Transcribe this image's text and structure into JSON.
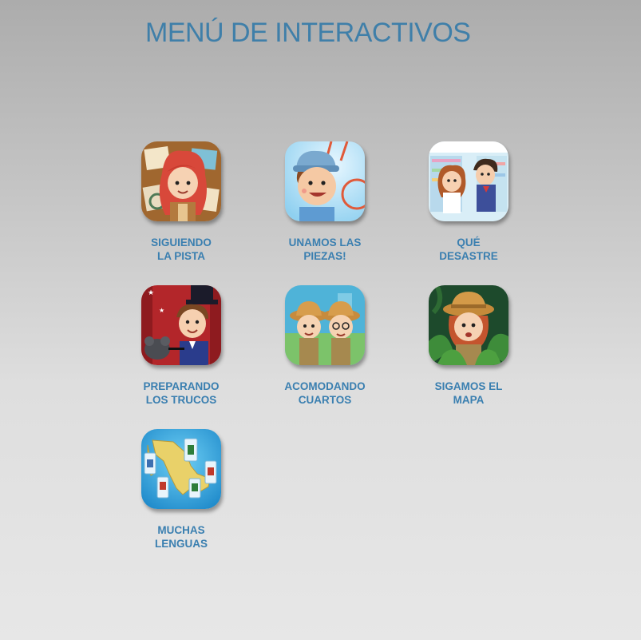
{
  "page": {
    "title": "MENÚ DE INTERACTIVOS"
  },
  "games": [
    {
      "line1": "SIGUIENDO",
      "line2": "LA PISTA"
    },
    {
      "line1": "UNAMOS LAS",
      "line2": "PIEZAS!"
    },
    {
      "line1": "QUÉ",
      "line2": "DESASTRE"
    },
    {
      "line1": "PREPARANDO",
      "line2": "LOS TRUCOS"
    },
    {
      "line1": "ACOMODANDO",
      "line2": "CUARTOS"
    },
    {
      "line1": "SIGAMOS EL",
      "line2": "MAPA"
    },
    {
      "line1": "MUCHAS",
      "line2": "LENGUAS"
    }
  ],
  "colors": {
    "title": "#3f7fa9",
    "label": "#3a7fb0"
  }
}
